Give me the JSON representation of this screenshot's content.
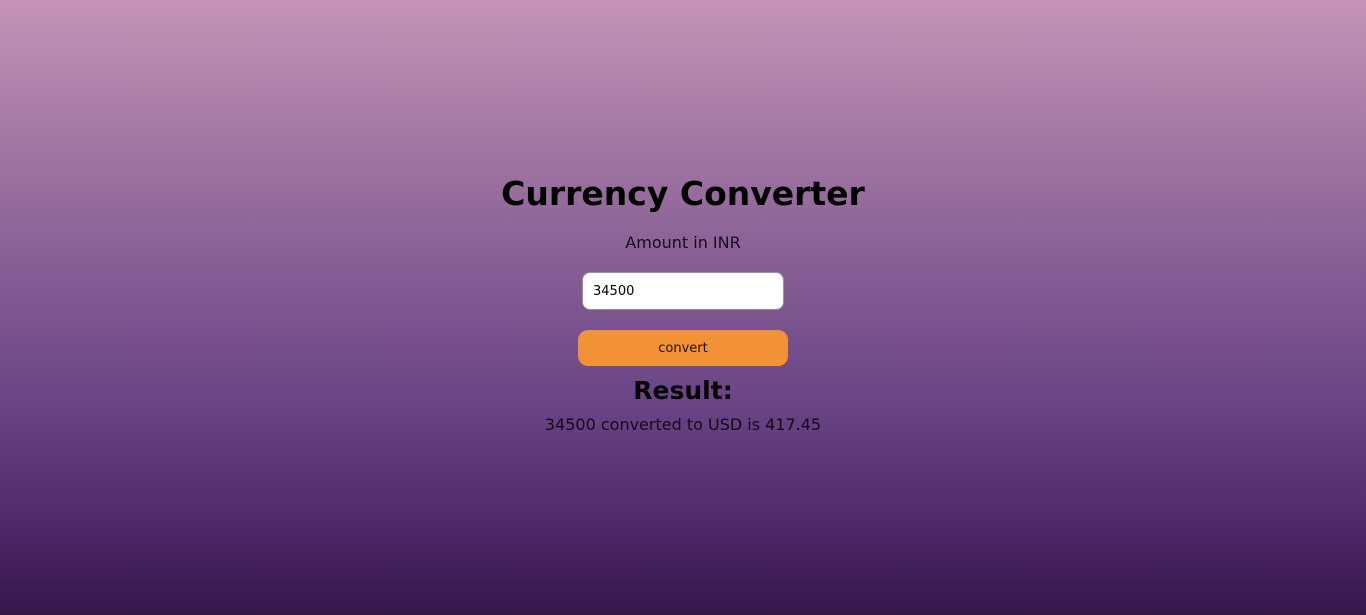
{
  "page": {
    "title": "Currency Converter"
  },
  "form": {
    "amount_label": "Amount in INR",
    "amount_value": "34500",
    "convert_label": "convert"
  },
  "result": {
    "heading": "Result:",
    "text": "34500 converted to USD is 417.45"
  },
  "colors": {
    "button": "#f09235",
    "gradient_top": "#c394b6",
    "gradient_bottom": "#341749"
  }
}
